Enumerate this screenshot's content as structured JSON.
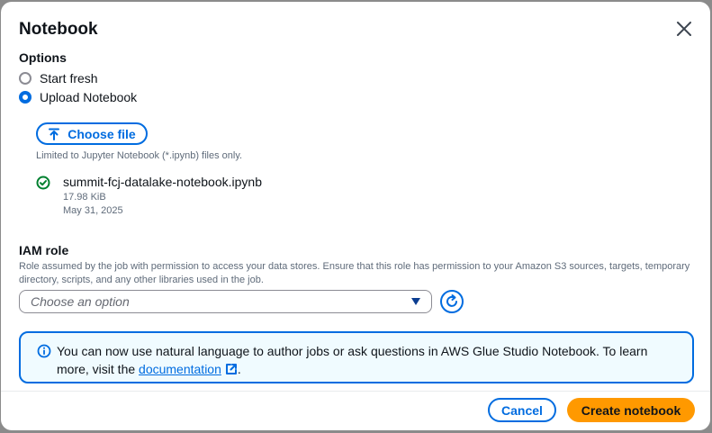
{
  "modal": {
    "title": "Notebook"
  },
  "options": {
    "label": "Options",
    "choices": [
      {
        "label": "Start fresh",
        "selected": false
      },
      {
        "label": "Upload Notebook",
        "selected": true
      }
    ]
  },
  "upload": {
    "button_label": "Choose file",
    "hint": "Limited to Jupyter Notebook (*.ipynb) files only.",
    "file": {
      "name": "summit-fcj-datalake-notebook.ipynb",
      "size": "17.98 KiB",
      "date": "May 31, 2025",
      "status_icon": "check-circle-icon"
    }
  },
  "iam": {
    "label": "IAM role",
    "description": "Role assumed by the job with permission to access your data stores. Ensure that this role has permission to your Amazon S3 sources, targets, temporary directory, scripts, and any other libraries used in the job.",
    "placeholder": "Choose an option"
  },
  "info": {
    "text_before": "You can now use natural language to author jobs or ask questions in AWS Glue Studio Notebook. To learn more, visit the ",
    "link": "documentation",
    "text_after": "."
  },
  "footer": {
    "cancel": "Cancel",
    "create": "Create notebook"
  },
  "colors": {
    "accent": "#006ce0",
    "primary_button": "#ff9900",
    "success": "#00802f",
    "info_bg": "#f0fbff"
  }
}
